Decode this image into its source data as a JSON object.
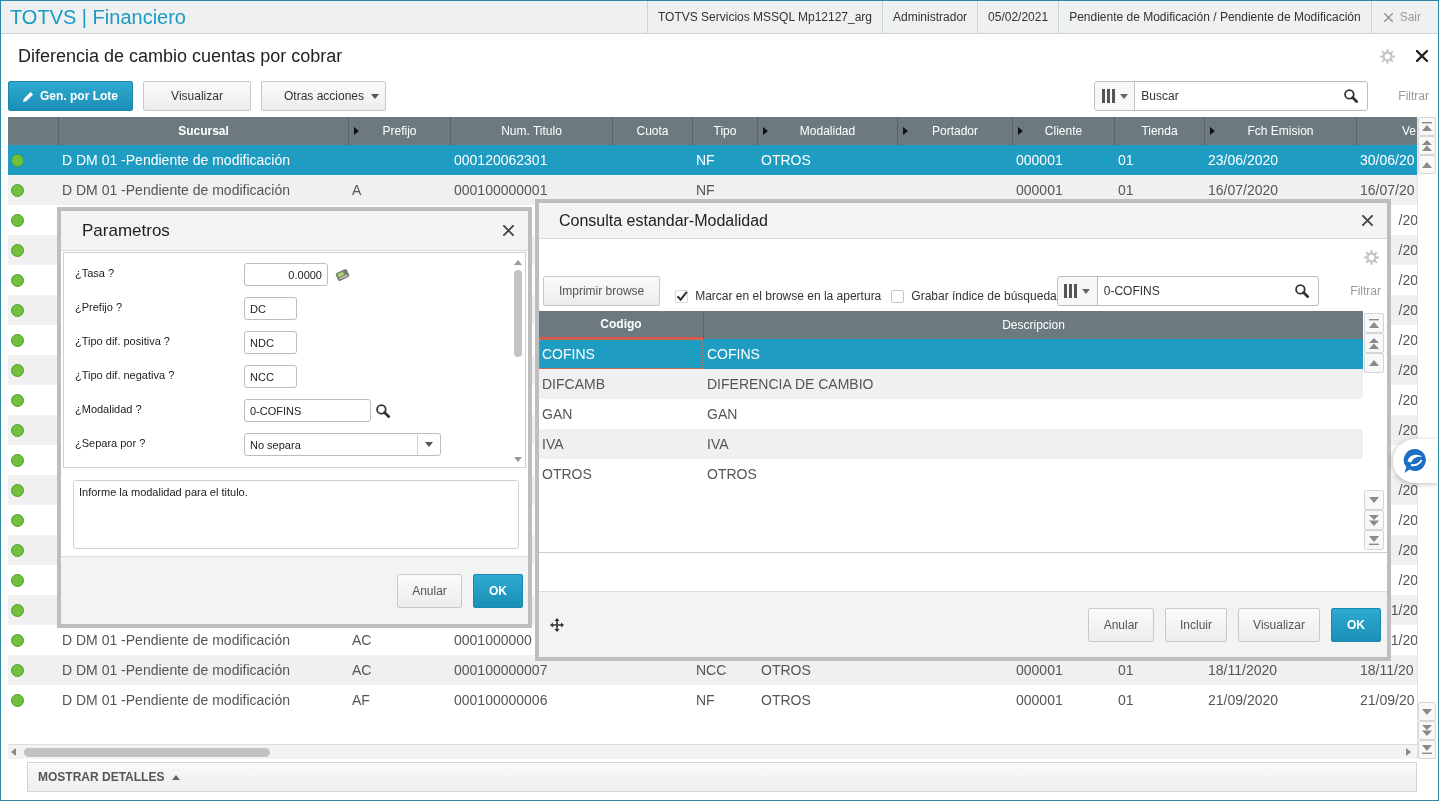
{
  "header": {
    "brand": "TOTVS | Financiero",
    "info": [
      "TOTVS Servicios MSSQL Mp12127_arg",
      "Administrador",
      "05/02/2021",
      "Pendiente de Modificación / Pendiente de Modificación"
    ],
    "exit": "Sair"
  },
  "page": {
    "title": "Diferencia de cambio cuentas por cobrar"
  },
  "toolbar": {
    "buttons": [
      {
        "label": "Gen. por Lote",
        "kind": "primary"
      },
      {
        "label": "Visualizar",
        "kind": "plain"
      },
      {
        "label": "Otras acciones",
        "kind": "menu"
      }
    ],
    "search": {
      "placeholder": "Buscar"
    },
    "filter": "Filtrar"
  },
  "table": {
    "columns": [
      {
        "label": "Sucursal",
        "arrow": false,
        "sorted": true
      },
      {
        "label": "Prefijo",
        "arrow": true,
        "sorted": false
      },
      {
        "label": "Num. Titulo",
        "arrow": false,
        "sorted": false
      },
      {
        "label": "Cuota",
        "arrow": false,
        "sorted": false
      },
      {
        "label": "Tipo",
        "arrow": false,
        "sorted": false
      },
      {
        "label": "Modalidad",
        "arrow": true,
        "sorted": false
      },
      {
        "label": "Portador",
        "arrow": true,
        "sorted": false
      },
      {
        "label": "Cliente",
        "arrow": true,
        "sorted": false
      },
      {
        "label": "Tienda",
        "arrow": false,
        "sorted": false
      },
      {
        "label": "Fch Emision",
        "arrow": true,
        "sorted": false
      },
      {
        "label": "Ve",
        "arrow": false,
        "sorted": false
      }
    ],
    "rows": [
      {
        "selected": true,
        "color": "#72c13e",
        "kind": "full",
        "cells": [
          "D DM 01 -Pendiente de modificación",
          null,
          "000120062301",
          null,
          "NF",
          "OTROS",
          null,
          "000001",
          "01",
          "23/06/2020",
          "30/06/20"
        ]
      },
      {
        "selected": false,
        "color": "#72c13e",
        "kind": "full",
        "cells": [
          "D DM 01 -Pendiente de modificación",
          "A",
          "000100000001",
          null,
          "NF",
          null,
          null,
          "000001",
          "01",
          "16/07/2020",
          "16/07/20"
        ]
      },
      {
        "selected": false,
        "color": "#72c13e",
        "kind": "covered",
        "fragment": "/20"
      },
      {
        "selected": false,
        "color": "#72c13e",
        "kind": "covered",
        "fragment": "/20"
      },
      {
        "selected": false,
        "color": "#72c13e",
        "kind": "covered",
        "fragment": "/20"
      },
      {
        "selected": false,
        "color": "#72c13e",
        "kind": "covered",
        "fragment": "/20"
      },
      {
        "selected": false,
        "color": "#72c13e",
        "kind": "covered",
        "fragment": "/20"
      },
      {
        "selected": false,
        "color": "#72c13e",
        "kind": "covered",
        "fragment": "/20"
      },
      {
        "selected": false,
        "color": "#72c13e",
        "kind": "covered",
        "fragment": "/20"
      },
      {
        "selected": false,
        "color": "#72c13e",
        "kind": "covered",
        "fragment": "/20"
      },
      {
        "selected": false,
        "color": "#72c13e",
        "kind": "covered"
      },
      {
        "selected": false,
        "color": "#72c13e",
        "kind": "covered",
        "fragment": "/20"
      },
      {
        "selected": false,
        "color": "#72c13e",
        "kind": "covered",
        "fragment": "/20"
      },
      {
        "selected": false,
        "color": "#72c13e",
        "kind": "covered",
        "fragment": "/20"
      },
      {
        "selected": false,
        "color": "#72c13e",
        "kind": "covered",
        "fragment": "/20"
      },
      {
        "selected": false,
        "color": "#72c13e",
        "kind": "covered",
        "fragment": "1/20"
      },
      {
        "selected": false,
        "color": "#72c13e",
        "kind": "covered",
        "cells": [
          "D DM 01 -Pendiente de modificación",
          "AC",
          "0001000000"
        ],
        "fragment": "1/20"
      },
      {
        "selected": false,
        "color": "#72c13e",
        "kind": "full",
        "cells": [
          "D DM 01 -Pendiente de modificación",
          "AC",
          "000100000007",
          null,
          "NCC",
          "OTROS",
          null,
          "000001",
          "01",
          "18/11/2020",
          "18/11/20"
        ]
      },
      {
        "selected": false,
        "color": "#72c13e",
        "kind": "full",
        "cells": [
          "D DM 01 -Pendiente de modificación",
          "AF",
          "000100000006",
          null,
          "NF",
          "OTROS",
          null,
          "000001",
          "01",
          "21/09/2020",
          "21/09/20"
        ]
      }
    ]
  },
  "details_bar": {
    "label": "MOSTRAR DETALLES",
    "expanded": false
  },
  "parameters_dialog": {
    "title": "Parametros",
    "fields": [
      {
        "label": "¿Tasa ?",
        "value": "0.0000",
        "kind": "number"
      },
      {
        "label": "¿Prefijo ?",
        "value": "DC",
        "kind": "text"
      },
      {
        "label": "¿Tipo dif. positiva ?",
        "value": "NDC",
        "kind": "text"
      },
      {
        "label": "¿Tipo dif. negativa ?",
        "value": "NCC",
        "kind": "text"
      },
      {
        "label": "¿Modalidad ?",
        "value": "0-COFINS",
        "kind": "lookup"
      },
      {
        "label": "¿Separa por ?",
        "value": "No separa",
        "kind": "select"
      }
    ],
    "help": "Informe la modalidad para el titulo.",
    "buttons": [
      {
        "label": "Anular",
        "kind": "plain"
      },
      {
        "label": "OK",
        "kind": "primary"
      }
    ]
  },
  "lookup_dialog": {
    "title": "Consulta estandar-Modalidad",
    "print_button": "Imprimir browse",
    "options": [
      {
        "label": "Marcar en el browse en la apertura",
        "checked": true
      },
      {
        "label": "Grabar índice de búsqueda",
        "checked": false
      }
    ],
    "search": {
      "value": "0-COFINS"
    },
    "filter": "Filtrar",
    "columns": [
      {
        "label": "Codigo",
        "sorted": true
      },
      {
        "label": "Descripcion",
        "sorted": false
      }
    ],
    "rows": [
      {
        "selected": true,
        "cells": [
          "COFINS",
          "COFINS"
        ]
      },
      {
        "selected": false,
        "cells": [
          "DIFCAMB",
          "DIFERENCIA DE CAMBIO"
        ]
      },
      {
        "selected": false,
        "cells": [
          "GAN",
          "GAN"
        ]
      },
      {
        "selected": false,
        "cells": [
          "IVA",
          "IVA"
        ]
      },
      {
        "selected": false,
        "cells": [
          "OTROS",
          "OTROS"
        ]
      }
    ],
    "buttons": [
      {
        "label": "Anular",
        "kind": "plain"
      },
      {
        "label": "Incluir",
        "kind": "plain"
      },
      {
        "label": "Visualizar",
        "kind": "plain"
      },
      {
        "label": "OK",
        "kind": "primary"
      }
    ]
  }
}
